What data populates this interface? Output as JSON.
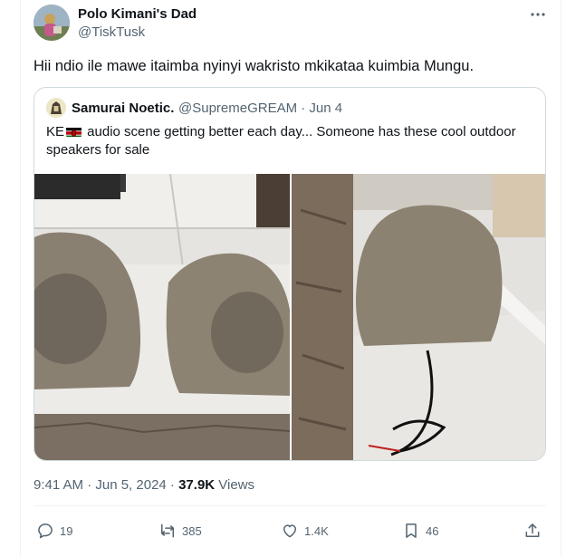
{
  "tweet": {
    "author_name": "Polo Kimani's Dad",
    "author_handle": "@TiskTusk",
    "text": "Hii ndio ile mawe itaimba nyinyi wakristo mkikataa kuimbia Mungu.",
    "more_icon": "more-icon",
    "timestamp": "9:41 AM · Jun 5, 2024 · ",
    "views_count": "37.9K",
    "views_label": " Views"
  },
  "quote": {
    "author_name": "Samurai Noetic.",
    "meta": "@SupremeGREAM · Jun 4",
    "text_before_flag": "KE",
    "text_after_flag": " audio scene getting better each day... Someone has these cool outdoor speakers for sale",
    "flag_icon": "kenya-flag-icon"
  },
  "actions": {
    "replies": "19",
    "reposts": "385",
    "likes": "1.4K",
    "bookmarks": "46"
  },
  "colors": {
    "text_primary": "#0f1419",
    "text_secondary": "#536471",
    "border": "#cfd9de"
  }
}
